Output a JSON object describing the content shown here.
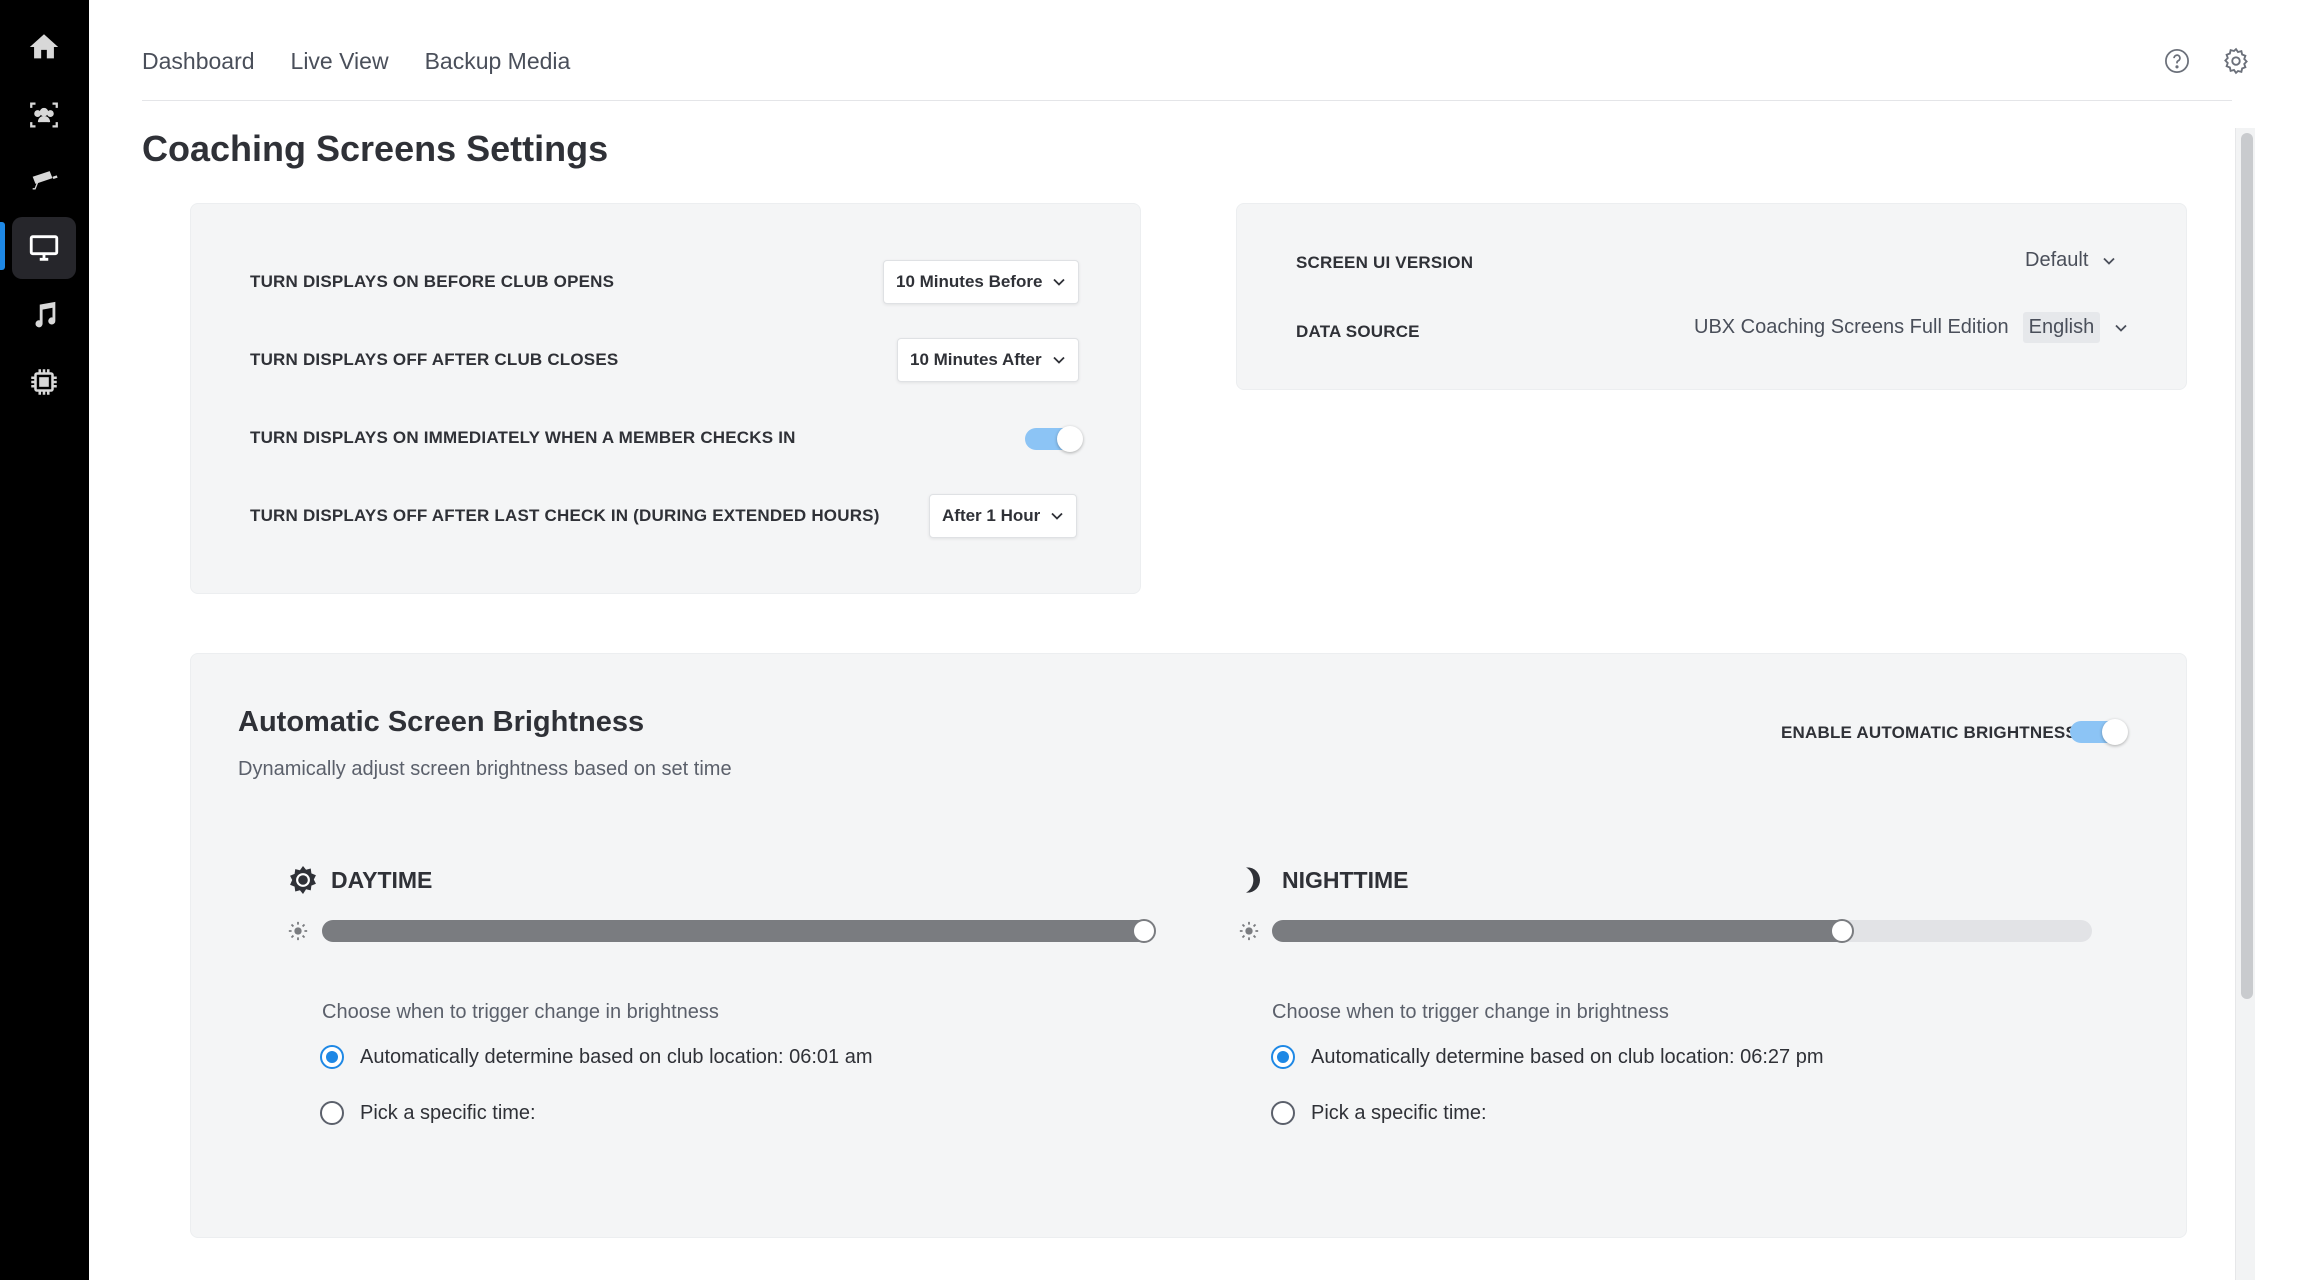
{
  "nav": {
    "items": [
      {
        "label": "Dashboard"
      },
      {
        "label": "Live View"
      },
      {
        "label": "Backup Media"
      }
    ]
  },
  "sidebar": {
    "icons": [
      "home-icon",
      "members-icon",
      "camera-icon",
      "display-icon",
      "music-icon",
      "chip-icon"
    ],
    "active": "display-icon",
    "accent": "#1e88e5"
  },
  "page": {
    "title": "Coaching Screens Settings"
  },
  "display_settings": {
    "rows": [
      {
        "label": "TURN DISPLAYS ON BEFORE CLUB OPENS",
        "value": "10 Minutes Before"
      },
      {
        "label": "TURN DISPLAYS OFF AFTER CLUB CLOSES",
        "value": "10 Minutes After"
      },
      {
        "label": "TURN DISPLAYS ON IMMEDIATELY WHEN A MEMBER CHECKS IN",
        "toggle": true
      },
      {
        "label": "TURN DISPLAYS OFF AFTER LAST CHECK IN (DURING EXTENDED HOURS)",
        "value": "After 1 Hour"
      }
    ]
  },
  "screen_settings": {
    "ui_version_label": "SCREEN UI VERSION",
    "ui_version_value": "Default",
    "data_source_label": "DATA SOURCE",
    "data_source_value": "UBX Coaching Screens Full Edition",
    "data_source_language": "English"
  },
  "brightness": {
    "title": "Automatic Screen Brightness",
    "subtitle": "Dynamically adjust screen brightness based on set time",
    "enable_label": "ENABLE AUTOMATIC BRIGHTNESS",
    "enabled": true,
    "daytime": {
      "label": "DAYTIME",
      "level": 1.0,
      "choose_label": "Choose when to trigger change in brightness",
      "auto_option": "Automatically determine based on club location: 06:01 am",
      "specific_option": "Pick a specific time:",
      "selected": "auto"
    },
    "nighttime": {
      "label": "NIGHTTIME",
      "level": 0.7,
      "choose_label": "Choose when to trigger change in brightness",
      "auto_option": "Automatically determine based on club location: 06:27 pm",
      "specific_option": "Pick a specific time:",
      "selected": "auto"
    }
  },
  "colors": {
    "toggle_on": "#8cc4f5",
    "radio_selected": "#1e88e5",
    "slider_fill": "#7a7c80"
  }
}
